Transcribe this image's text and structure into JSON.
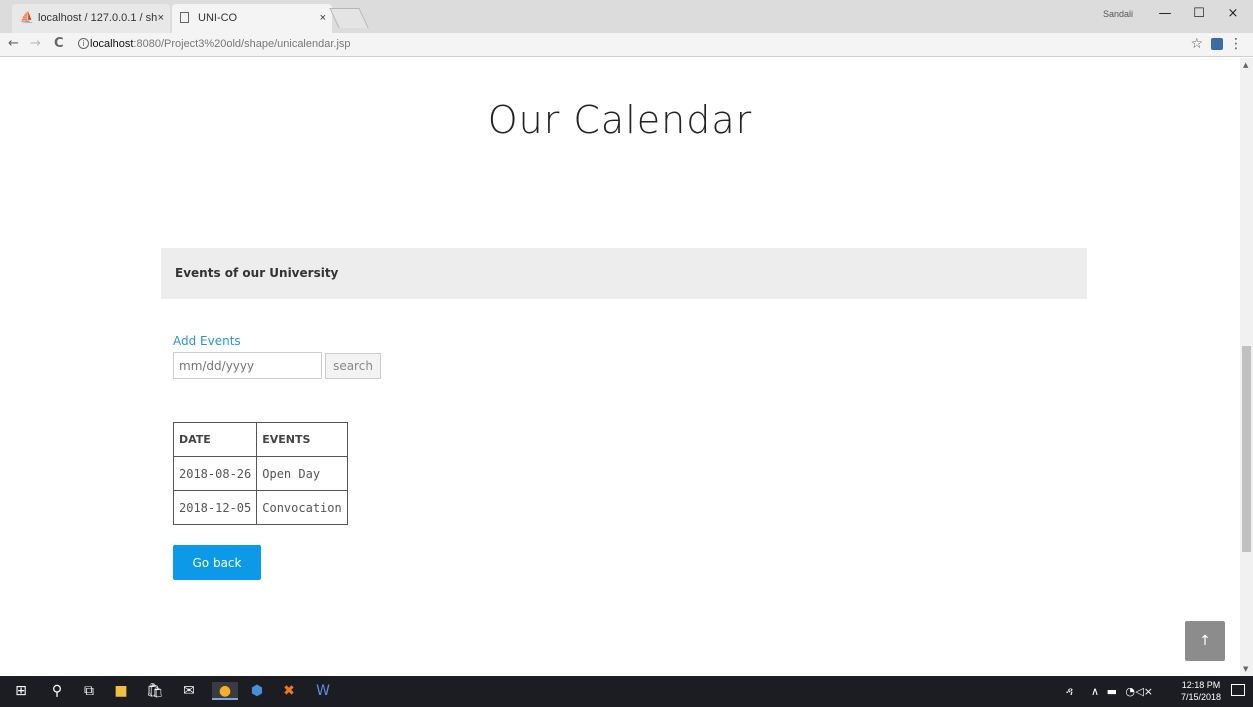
{
  "browser": {
    "tabs": [
      {
        "label": "localhost / 127.0.0.1 / sh",
        "icon": "phpmyadmin-icon",
        "close": "×"
      },
      {
        "label": "UNI-CO",
        "icon": "page-icon",
        "close": "×"
      }
    ],
    "user_label": "Sandali",
    "window_controls": {
      "minimize": "—",
      "maximize": "☐",
      "close": "×"
    },
    "nav": {
      "back": "←",
      "forward": "→",
      "reload": "C"
    },
    "url": {
      "host": "localhost",
      "path": ":8080/Project3%20old/shape/unicalendar.jsp"
    },
    "star": "☆",
    "menu": "⋮"
  },
  "page": {
    "title": "Our Calendar",
    "events_header": "Events of our University",
    "add_events_label": "Add Events",
    "date_placeholder": "mm/dd/yyyy",
    "search_label": "search",
    "table": {
      "headers": [
        "DATE",
        "EVENTS"
      ],
      "rows": [
        [
          "2018-08-26",
          "Open Day"
        ],
        [
          "2018-12-05",
          "Convocation"
        ]
      ]
    },
    "go_back_label": "Go back",
    "scroll_top_label": "↑",
    "colors": {
      "accent": "#0c9ae8",
      "link": "#2b93d6",
      "header_bg": "#ededed"
    }
  },
  "taskbar": {
    "clock_time": "12:18 PM",
    "clock_date": "7/15/2018",
    "icons": [
      "windows-start-icon",
      "search-icon",
      "task-view-icon",
      "file-explorer-icon",
      "store-icon",
      "mail-icon",
      "chrome-icon",
      "virtualbox-icon",
      "xampp-icon",
      "word-icon"
    ]
  }
}
